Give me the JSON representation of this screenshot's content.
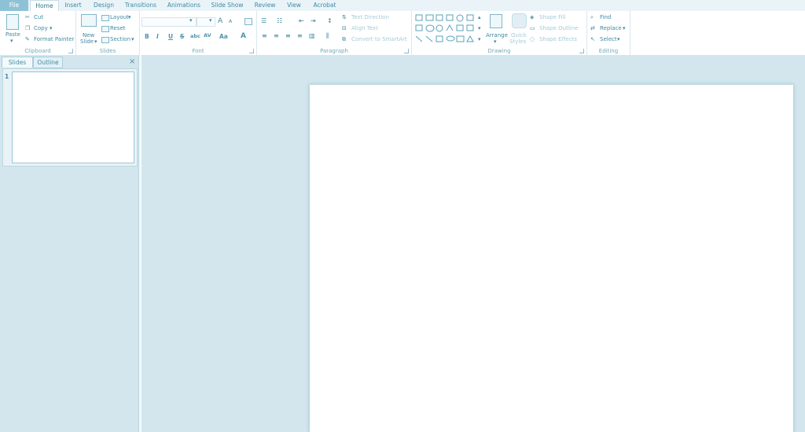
{
  "tabs": [
    {
      "label": "File"
    },
    {
      "label": "Home"
    },
    {
      "label": "Insert"
    },
    {
      "label": "Design"
    },
    {
      "label": "Transitions"
    },
    {
      "label": "Animations"
    },
    {
      "label": "Slide Show"
    },
    {
      "label": "Review"
    },
    {
      "label": "View"
    },
    {
      "label": "Acrobat"
    }
  ],
  "clipboard": {
    "label": "Clipboard",
    "paste": "Paste",
    "cut": "Cut",
    "copy": "Copy",
    "format_painter": "Format Painter"
  },
  "slides_group": {
    "label": "Slides",
    "new_slide": "New",
    "new_slide2": "Slide",
    "layout": "Layout",
    "reset": "Reset",
    "section": "Section"
  },
  "font": {
    "label": "Font",
    "bold": "B",
    "italic": "I",
    "underline": "U",
    "strike": "S",
    "shadow": "abc",
    "spacing": "AV",
    "case": "Aa",
    "grow": "A",
    "shrink": "A",
    "color": "A"
  },
  "paragraph": {
    "label": "Paragraph",
    "text_direction": "Text Direction",
    "align_text": "Align Text",
    "convert": "Convert to SmartArt"
  },
  "drawing": {
    "label": "Drawing",
    "arrange": "Arrange",
    "quick": "Quick",
    "styles": "Styles",
    "shape_fill": "Shape Fill",
    "shape_outline": "Shape Outline",
    "shape_effects": "Shape Effects"
  },
  "editing": {
    "label": "Editing",
    "find": "Find",
    "replace": "Replace",
    "select": "Select"
  },
  "pane": {
    "tab_slides": "Slides",
    "tab_outline": "Outline",
    "close": "×",
    "slide_number": "1"
  },
  "colors": {
    "accent": "#8dc2d6",
    "background": "#d3e6ee"
  }
}
